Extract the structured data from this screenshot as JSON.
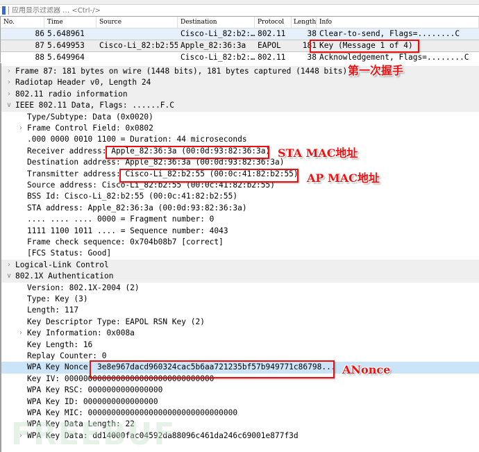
{
  "filter": {
    "placeholder": "应用显示过滤器 … <Ctrl-/>"
  },
  "packet_list": {
    "columns": [
      "No.",
      "Time",
      "Source",
      "Destination",
      "Protocol",
      "Length",
      "Info"
    ],
    "rows": [
      {
        "no": "86",
        "time": "5.648961",
        "source": "",
        "destination": "Cisco-Li_82:b2:…",
        "protocol": "802.11",
        "length": "38",
        "info": "Clear-to-send, Flags=........C"
      },
      {
        "no": "87",
        "time": "5.649953",
        "source": "Cisco-Li_82:b2:55",
        "destination": "Apple_82:36:3a",
        "protocol": "EAPOL",
        "length": "181",
        "info": "Key (Message 1 of 4)"
      },
      {
        "no": "88",
        "time": "5.649964",
        "source": "",
        "destination": "Cisco-Li_82:b2:…",
        "protocol": "802.11",
        "length": "38",
        "info": "Acknowledgement, Flags=........C"
      }
    ]
  },
  "details": [
    {
      "indent": 0,
      "toggle": "collapsed",
      "text": "Frame 87: 181 bytes on wire (1448 bits), 181 bytes captured (1448 bits)"
    },
    {
      "indent": 0,
      "toggle": "collapsed",
      "text": "Radiotap Header v0, Length 24"
    },
    {
      "indent": 0,
      "toggle": "collapsed",
      "text": "802.11 radio information"
    },
    {
      "indent": 0,
      "toggle": "expanded",
      "text": "IEEE 802.11 Data, Flags: ......F.C"
    },
    {
      "indent": 1,
      "toggle": "none",
      "text": "Type/Subtype: Data (0x0020)"
    },
    {
      "indent": 1,
      "toggle": "collapsed",
      "text": "Frame Control Field: 0x0802"
    },
    {
      "indent": 1,
      "toggle": "none",
      "text": ".000 0000 0010 1100 = Duration: 44 microseconds"
    },
    {
      "indent": 1,
      "toggle": "none",
      "text": "Receiver address: Apple_82:36:3a (00:0d:93:82:36:3a)"
    },
    {
      "indent": 1,
      "toggle": "none",
      "text": "Destination address: Apple_82:36:3a (00:0d:93:82:36:3a)"
    },
    {
      "indent": 1,
      "toggle": "none",
      "text": "Transmitter address: Cisco-Li_82:b2:55 (00:0c:41:82:b2:55)"
    },
    {
      "indent": 1,
      "toggle": "none",
      "text": "Source address: Cisco-Li_82:b2:55 (00:0c:41:82:b2:55)"
    },
    {
      "indent": 1,
      "toggle": "none",
      "text": "BSS Id: Cisco-Li_82:b2:55 (00:0c:41:82:b2:55)"
    },
    {
      "indent": 1,
      "toggle": "none",
      "text": "STA address: Apple_82:36:3a (00:0d:93:82:36:3a)"
    },
    {
      "indent": 1,
      "toggle": "none",
      "text": ".... .... .... 0000 = Fragment number: 0"
    },
    {
      "indent": 1,
      "toggle": "none",
      "text": "1111 1100 1011 .... = Sequence number: 4043"
    },
    {
      "indent": 1,
      "toggle": "none",
      "text": "Frame check sequence: 0x704b08b7 [correct]"
    },
    {
      "indent": 1,
      "toggle": "none",
      "text": "[FCS Status: Good]"
    },
    {
      "indent": 0,
      "toggle": "collapsed",
      "text": "Logical-Link Control"
    },
    {
      "indent": 0,
      "toggle": "expanded",
      "text": "802.1X Authentication"
    },
    {
      "indent": 1,
      "toggle": "none",
      "text": "Version: 802.1X-2004 (2)"
    },
    {
      "indent": 1,
      "toggle": "none",
      "text": "Type: Key (3)"
    },
    {
      "indent": 1,
      "toggle": "none",
      "text": "Length: 117"
    },
    {
      "indent": 1,
      "toggle": "none",
      "text": "Key Descriptor Type: EAPOL RSN Key (2)"
    },
    {
      "indent": 1,
      "toggle": "collapsed",
      "text": "Key Information: 0x008a"
    },
    {
      "indent": 1,
      "toggle": "none",
      "text": "Key Length: 16"
    },
    {
      "indent": 1,
      "toggle": "none",
      "text": "Replay Counter: 0"
    },
    {
      "indent": 1,
      "toggle": "none",
      "text": "WPA Key Nonce: 3e8e967dacd960324cac5b6aa721235bf57b949771c86798..."
    },
    {
      "indent": 1,
      "toggle": "none",
      "text": "Key IV: 00000000000000000000000000000000"
    },
    {
      "indent": 1,
      "toggle": "none",
      "text": "WPA Key RSC: 0000000000000000"
    },
    {
      "indent": 1,
      "toggle": "none",
      "text": "WPA Key ID: 0000000000000000"
    },
    {
      "indent": 1,
      "toggle": "none",
      "text": "WPA Key MIC: 00000000000000000000000000000000"
    },
    {
      "indent": 1,
      "toggle": "none",
      "text": "WPA Key Data Length: 22"
    },
    {
      "indent": 1,
      "toggle": "collapsed",
      "text": "WPA Key Data: dd14000fac04592da88096c461da246c69001e877f3d"
    }
  ],
  "annotations": {
    "handshake": "第一次握手",
    "sta_mac": "STA MAC地址",
    "ap_mac": "AP MAC地址",
    "anonce": "ANonce"
  },
  "watermark": "FREEBUF",
  "colors": {
    "annotation_red": "#e81010",
    "selected_row": "#cce4f7",
    "highlight_row": "#e6f0fb"
  }
}
